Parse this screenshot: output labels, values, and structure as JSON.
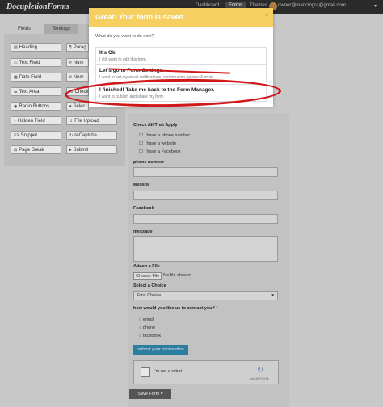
{
  "topbar": {
    "logo": "DocupletionForms",
    "nav": [
      "Dashboard",
      "Forms",
      "Themes"
    ],
    "active_nav": "Forms",
    "user": "owner@mancingra@gmail.com",
    "caret": "▾"
  },
  "left": {
    "tabs": [
      "Fields",
      "Settings"
    ],
    "fields_col1": [
      "Heading",
      "Text Field",
      "Date Field",
      "Text Area",
      "Radio Buttons",
      "Hidden Field",
      "<> Snippet",
      "Page Break"
    ],
    "fields_col2": [
      "Parag",
      "Num",
      "Num",
      "Check",
      "Selec",
      "File Upload",
      "reCaptcha",
      "Submit"
    ]
  },
  "form": {
    "check_label": "Check All That Apply",
    "check_options": [
      "I have a phone number",
      "I have a website",
      "I have a Facebook"
    ],
    "phone_label": "phone number",
    "website_label": "website",
    "facebook_label": "Facebook",
    "message_label": "message",
    "file_label": "Attach a File",
    "file_button": "Choose File",
    "file_status": "No file chosen",
    "select_label": "Select a Choice",
    "select_value": "First Choice",
    "contact_label": "how would you like us to contact you?",
    "required_mark": "*",
    "contact_options": [
      "email",
      "phone",
      "facebook"
    ],
    "submit_label": "submit your information",
    "captcha_label": "I'm not a robot",
    "captcha_brand": "reCAPTCHA",
    "save_label": "Save Form"
  },
  "modal": {
    "title": "Great! Your form is saved.",
    "close": "×",
    "question": "What do you want to do now?",
    "choices": [
      {
        "title": "It's Ok.",
        "sub": "I still want to edit this form."
      },
      {
        "title": "Let's go to Form Settings.",
        "sub": "I want to set my email notifications, confirmation options & more."
      },
      {
        "title": "I finished! Take me back to the Form Manager.",
        "sub": "I want to publish and share my form."
      }
    ]
  },
  "colors": {
    "modal_header": "#f5d061",
    "annotation": "#d0181a",
    "submit": "#2b7e9e"
  }
}
